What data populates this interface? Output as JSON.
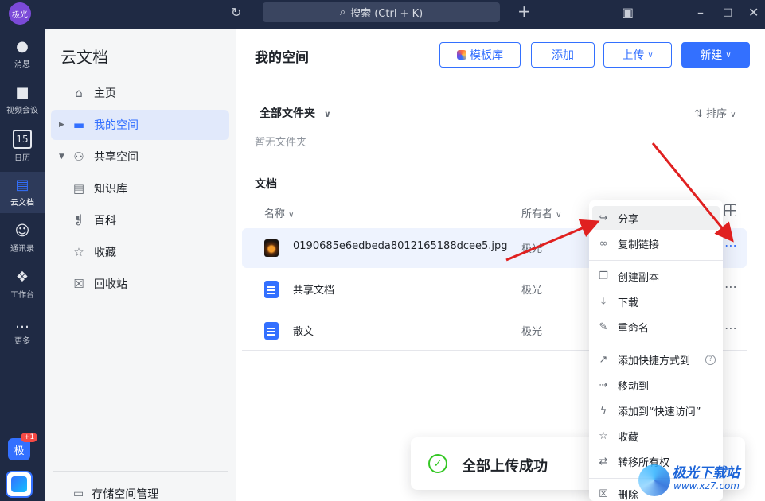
{
  "titlebar": {
    "avatar": "极光",
    "search_label": "搜索 (Ctrl + K)",
    "icons": [
      "history-icon",
      "search-icon",
      "plus-icon",
      "screen-search-icon",
      "minimize-icon",
      "maximize-icon",
      "close-icon"
    ]
  },
  "rail": {
    "items": [
      {
        "label": "消息",
        "icon": "message-icon"
      },
      {
        "label": "视频会议",
        "icon": "video-icon"
      },
      {
        "label": "日历",
        "icon": "calendar-icon",
        "glyph": "15"
      },
      {
        "label": "云文档",
        "icon": "cloud-doc-icon"
      },
      {
        "label": "通讯录",
        "icon": "contacts-icon"
      },
      {
        "label": "工作台",
        "icon": "workspace-icon"
      },
      {
        "label": "更多",
        "icon": "more-icon"
      }
    ],
    "user_avatar": "极",
    "badge": "+1"
  },
  "sidebar": {
    "title": "云文档",
    "items": [
      {
        "label": "主页",
        "icon": "home-icon"
      },
      {
        "label": "我的空间",
        "icon": "folder-icon"
      },
      {
        "label": "共享空间",
        "icon": "users-icon"
      },
      {
        "label": "知识库",
        "icon": "book-icon"
      },
      {
        "label": "百科",
        "icon": "encyclopedia-icon"
      },
      {
        "label": "收藏",
        "icon": "star-icon"
      },
      {
        "label": "回收站",
        "icon": "trash-icon"
      }
    ],
    "storage_label": "存储空间管理"
  },
  "main": {
    "title": "我的空间",
    "buttons": {
      "template": "模板库",
      "add": "添加",
      "upload": "上传",
      "new": "新建"
    },
    "folders_header": "全部文件夹",
    "sort_label": "排序",
    "no_folders": "暂无文件夹",
    "docs_header": "文档",
    "columns": {
      "name": "名称",
      "owner": "所有者"
    },
    "rows": [
      {
        "name": "0190685e6edbeda8012165188dcee5.jpg",
        "owner": "极光",
        "type": "image"
      },
      {
        "name": "共享文档",
        "owner": "极光",
        "type": "doc"
      },
      {
        "name": "散文",
        "owner": "极光",
        "type": "doc"
      }
    ]
  },
  "context_menu": {
    "items": [
      {
        "label": "分享",
        "icon": "share-icon"
      },
      {
        "label": "复制链接",
        "icon": "link-icon"
      },
      {
        "label": "创建副本",
        "icon": "copy-icon"
      },
      {
        "label": "下载",
        "icon": "download-icon"
      },
      {
        "label": "重命名",
        "icon": "rename-icon"
      },
      {
        "label": "添加快捷方式到",
        "icon": "shortcut-icon"
      },
      {
        "label": "移动到",
        "icon": "move-icon"
      },
      {
        "label": "添加到“快速访问”",
        "icon": "bolt-icon"
      },
      {
        "label": "收藏",
        "icon": "star-icon"
      },
      {
        "label": "转移所有权",
        "icon": "transfer-icon"
      },
      {
        "label": "删除",
        "icon": "trash-icon"
      }
    ]
  },
  "toast": {
    "message": "全部上传成功"
  },
  "watermark": {
    "brand": "极光下载站",
    "url": "www.xz7.com"
  },
  "colors": {
    "accent": "#3370ff",
    "rail_bg": "#1f2a44",
    "success": "#34c724",
    "annotation": "#e02020"
  }
}
